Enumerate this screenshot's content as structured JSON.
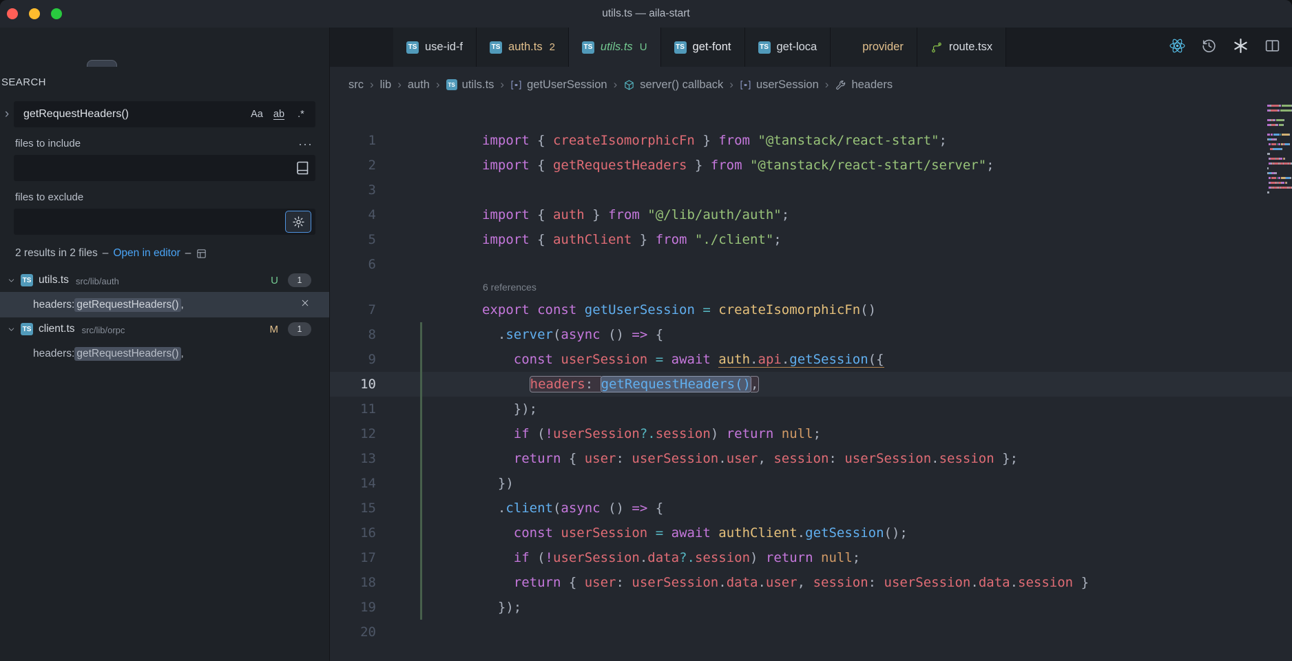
{
  "window": {
    "title": "utils.ts — aila-start"
  },
  "activity_bar": {
    "items": [
      {
        "name": "copy",
        "icon": "copy"
      },
      {
        "name": "search",
        "icon": "search",
        "active": true
      },
      {
        "name": "source-control",
        "icon": "source-control"
      },
      {
        "name": "dependencies",
        "icon": "cube"
      },
      {
        "name": "extensions",
        "icon": "extensions"
      },
      {
        "name": "more-views",
        "icon": "chevron-down"
      }
    ]
  },
  "search": {
    "heading": "SEARCH",
    "query": "getRequestHeaders()",
    "toggle_match_case": "Aa",
    "toggle_whole_word": "ab",
    "toggle_regex": ".*",
    "include_label": "files to include",
    "include_value": "",
    "exclude_label": "files to exclude",
    "exclude_value": "",
    "summary": {
      "count_text": "2 results in 2 files",
      "sep": "–",
      "link": "Open in editor",
      "sep2": "–"
    },
    "results": [
      {
        "file": "utils.ts",
        "path": "src/lib/auth",
        "git": "U",
        "git_color": "#73c991",
        "count": "1",
        "matches": [
          {
            "pre": "headers: ",
            "match": "getRequestHeaders()",
            "post": ",",
            "selected": true
          }
        ]
      },
      {
        "file": "client.ts",
        "path": "src/lib/orpc",
        "git": "M",
        "git_color": "#e2c08d",
        "count": "1",
        "matches": [
          {
            "pre": "headers: ",
            "match": "getRequestHeaders()",
            "post": ",",
            "selected": false
          }
        ]
      }
    ]
  },
  "tabs": [
    {
      "label": "use-id-f",
      "icon": "ts",
      "color": "#d6dae0"
    },
    {
      "label": "auth.ts",
      "icon": "ts",
      "color": "#e2c08d",
      "decoration": "2"
    },
    {
      "label": "utils.ts",
      "icon": "ts",
      "color": "#73c991",
      "decoration": "U",
      "active": true,
      "italic": true
    },
    {
      "label": "get-font",
      "icon": "ts",
      "color": "#e8eaee"
    },
    {
      "label": "get-loca",
      "icon": "ts",
      "color": "#d6dae0"
    },
    {
      "label": "provider",
      "icon": "react-pink",
      "color": "#e2c08d"
    },
    {
      "label": "route.tsx",
      "icon": "route",
      "color": "#d6dae0"
    }
  ],
  "tab_actions": [
    {
      "name": "react-devtools",
      "icon": "react",
      "color": "#56c0ea"
    },
    {
      "name": "timeline-history",
      "icon": "history",
      "color": "#a7aeba"
    },
    {
      "name": "openai-assistant",
      "icon": "openai",
      "color": "#d5dae0"
    },
    {
      "name": "split-editor",
      "icon": "split",
      "color": "#a7aeba"
    }
  ],
  "breadcrumbs": [
    {
      "label": "src"
    },
    {
      "label": "lib"
    },
    {
      "label": "auth"
    },
    {
      "label": "utils.ts",
      "icon": "ts"
    },
    {
      "label": "getUserSession",
      "icon": "symbol-field"
    },
    {
      "label": "server() callback",
      "icon": "symbol-namespace"
    },
    {
      "label": "userSession",
      "icon": "symbol-field"
    },
    {
      "label": "headers",
      "icon": "symbol-wrench"
    }
  ],
  "editor": {
    "palette": {
      "kw": "#c678dd",
      "str": "#98c379",
      "fn": "#61afef",
      "var": "#e06c75",
      "cls": "#e5c07b",
      "num": "#d19a66",
      "pun": "#abb2bf",
      "op": "#56b6c2"
    },
    "lines": [
      {
        "n": 1,
        "tokens": [
          [
            "kw",
            "import"
          ],
          [
            "pun",
            " { "
          ],
          [
            "var",
            "createIsomorphicFn"
          ],
          [
            "pun",
            " } "
          ],
          [
            "kw",
            "from"
          ],
          [
            "pun",
            " "
          ],
          [
            "str",
            "\"@tanstack/react-start\""
          ],
          [
            "pun",
            ";"
          ]
        ]
      },
      {
        "n": 2,
        "tokens": [
          [
            "kw",
            "import"
          ],
          [
            "pun",
            " { "
          ],
          [
            "var",
            "getRequestHeaders"
          ],
          [
            "pun",
            " } "
          ],
          [
            "kw",
            "from"
          ],
          [
            "pun",
            " "
          ],
          [
            "str",
            "\"@tanstack/react-start/server\""
          ],
          [
            "pun",
            ";"
          ]
        ]
      },
      {
        "n": 3,
        "tokens": []
      },
      {
        "n": 4,
        "tokens": [
          [
            "kw",
            "import"
          ],
          [
            "pun",
            " { "
          ],
          [
            "var",
            "auth"
          ],
          [
            "pun",
            " } "
          ],
          [
            "kw",
            "from"
          ],
          [
            "pun",
            " "
          ],
          [
            "str",
            "\"@/lib/auth/auth\""
          ],
          [
            "pun",
            ";"
          ]
        ]
      },
      {
        "n": 5,
        "tokens": [
          [
            "kw",
            "import"
          ],
          [
            "pun",
            " { "
          ],
          [
            "var",
            "authClient"
          ],
          [
            "pun",
            " } "
          ],
          [
            "kw",
            "from"
          ],
          [
            "pun",
            " "
          ],
          [
            "str",
            "\"./client\""
          ],
          [
            "pun",
            ";"
          ]
        ]
      },
      {
        "n": 6,
        "tokens": []
      },
      {
        "codelens": "6 references"
      },
      {
        "n": 7,
        "tokens": [
          [
            "kw",
            "export"
          ],
          [
            "pun",
            " "
          ],
          [
            "kw",
            "const"
          ],
          [
            "pun",
            " "
          ],
          [
            "fn",
            "getUserSession"
          ],
          [
            "pun",
            " "
          ],
          [
            "op",
            "="
          ],
          [
            "pun",
            " "
          ],
          [
            "cls",
            "createIsomorphicFn"
          ],
          [
            "pun",
            "()"
          ]
        ]
      },
      {
        "n": 8,
        "git": true,
        "tokens": [
          [
            "pun",
            "  ."
          ],
          [
            "fn",
            "server"
          ],
          [
            "pun",
            "("
          ],
          [
            "kw",
            "async"
          ],
          [
            "pun",
            " () "
          ],
          [
            "kw",
            "=>"
          ],
          [
            "pun",
            " {"
          ]
        ]
      },
      {
        "n": 9,
        "git": true,
        "tokens": [
          [
            "pun",
            "    "
          ],
          [
            "kw",
            "const"
          ],
          [
            "pun",
            " "
          ],
          [
            "var",
            "userSession"
          ],
          [
            "pun",
            " "
          ],
          [
            "op",
            "="
          ],
          [
            "pun",
            " "
          ],
          [
            "kw",
            "await"
          ],
          [
            "pun",
            " "
          ],
          [
            "cls",
            "auth",
            "underline"
          ],
          [
            "pun",
            ".",
            "underline"
          ],
          [
            "var",
            "api",
            "underline"
          ],
          [
            "pun",
            ".",
            "underline"
          ],
          [
            "fn",
            "getSession",
            "underline"
          ],
          [
            "pun",
            "({",
            "underline"
          ]
        ]
      },
      {
        "n": 10,
        "git": true,
        "active": true,
        "tokens": [
          [
            "pun",
            "      "
          ],
          [
            "var",
            "headers",
            "frame-start"
          ],
          [
            "pun",
            ": ",
            "frame"
          ],
          [
            "fn",
            "getRequestHeaders()",
            "sel"
          ],
          [
            "pun",
            ",",
            "frame-end"
          ]
        ]
      },
      {
        "n": 11,
        "git": true,
        "tokens": [
          [
            "pun",
            "    });"
          ]
        ]
      },
      {
        "n": 12,
        "git": true,
        "tokens": [
          [
            "pun",
            "    "
          ],
          [
            "kw",
            "if"
          ],
          [
            "pun",
            " ("
          ],
          [
            "kw",
            "!"
          ],
          [
            "var",
            "userSession"
          ],
          [
            "op",
            "?."
          ],
          [
            "var",
            "session"
          ],
          [
            "pun",
            ") "
          ],
          [
            "kw",
            "return"
          ],
          [
            "pun",
            " "
          ],
          [
            "num",
            "null"
          ],
          [
            "pun",
            ";"
          ]
        ]
      },
      {
        "n": 13,
        "git": true,
        "tokens": [
          [
            "pun",
            "    "
          ],
          [
            "kw",
            "return"
          ],
          [
            "pun",
            " { "
          ],
          [
            "var",
            "user"
          ],
          [
            "pun",
            ": "
          ],
          [
            "var",
            "userSession"
          ],
          [
            "pun",
            "."
          ],
          [
            "var",
            "user"
          ],
          [
            "pun",
            ", "
          ],
          [
            "var",
            "session"
          ],
          [
            "pun",
            ": "
          ],
          [
            "var",
            "userSession"
          ],
          [
            "pun",
            "."
          ],
          [
            "var",
            "session"
          ],
          [
            "pun",
            " };"
          ]
        ]
      },
      {
        "n": 14,
        "git": true,
        "tokens": [
          [
            "pun",
            "  })"
          ]
        ]
      },
      {
        "n": 15,
        "git": true,
        "tokens": [
          [
            "pun",
            "  ."
          ],
          [
            "fn",
            "client"
          ],
          [
            "pun",
            "("
          ],
          [
            "kw",
            "async"
          ],
          [
            "pun",
            " () "
          ],
          [
            "kw",
            "=>"
          ],
          [
            "pun",
            " {"
          ]
        ]
      },
      {
        "n": 16,
        "git": true,
        "tokens": [
          [
            "pun",
            "    "
          ],
          [
            "kw",
            "const"
          ],
          [
            "pun",
            " "
          ],
          [
            "var",
            "userSession"
          ],
          [
            "pun",
            " "
          ],
          [
            "op",
            "="
          ],
          [
            "pun",
            " "
          ],
          [
            "kw",
            "await"
          ],
          [
            "pun",
            " "
          ],
          [
            "cls",
            "authClient"
          ],
          [
            "pun",
            "."
          ],
          [
            "fn",
            "getSession"
          ],
          [
            "pun",
            "();"
          ]
        ]
      },
      {
        "n": 17,
        "git": true,
        "tokens": [
          [
            "pun",
            "    "
          ],
          [
            "kw",
            "if"
          ],
          [
            "pun",
            " ("
          ],
          [
            "kw",
            "!"
          ],
          [
            "var",
            "userSession"
          ],
          [
            "pun",
            "."
          ],
          [
            "var",
            "data"
          ],
          [
            "op",
            "?."
          ],
          [
            "var",
            "session"
          ],
          [
            "pun",
            ") "
          ],
          [
            "kw",
            "return"
          ],
          [
            "pun",
            " "
          ],
          [
            "num",
            "null"
          ],
          [
            "pun",
            ";"
          ]
        ]
      },
      {
        "n": 18,
        "git": true,
        "tokens": [
          [
            "pun",
            "    "
          ],
          [
            "kw",
            "return"
          ],
          [
            "pun",
            " { "
          ],
          [
            "var",
            "user"
          ],
          [
            "pun",
            ": "
          ],
          [
            "var",
            "userSession"
          ],
          [
            "pun",
            "."
          ],
          [
            "var",
            "data"
          ],
          [
            "pun",
            "."
          ],
          [
            "var",
            "user"
          ],
          [
            "pun",
            ", "
          ],
          [
            "var",
            "session"
          ],
          [
            "pun",
            ": "
          ],
          [
            "var",
            "userSession"
          ],
          [
            "pun",
            "."
          ],
          [
            "var",
            "data"
          ],
          [
            "pun",
            "."
          ],
          [
            "var",
            "session"
          ],
          [
            "pun",
            " }"
          ]
        ]
      },
      {
        "n": 19,
        "git": true,
        "tokens": [
          [
            "pun",
            "  });"
          ]
        ]
      },
      {
        "n": 20,
        "tokens": []
      }
    ]
  }
}
